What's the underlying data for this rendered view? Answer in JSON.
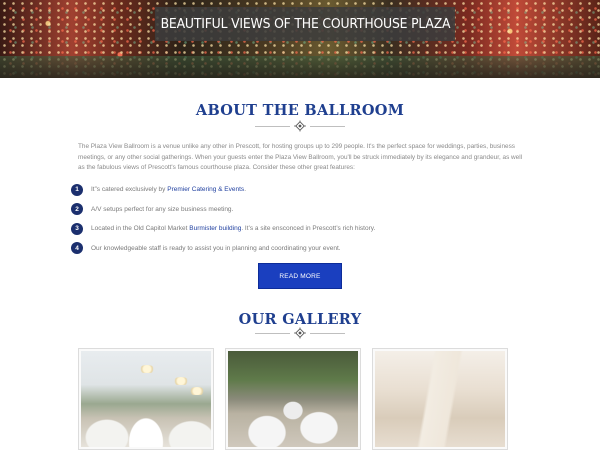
{
  "hero": {
    "title": "BEAUTIFUL VIEWS OF THE COURTHOUSE PLAZA"
  },
  "about": {
    "title": "ABOUT THE BALLROOM",
    "intro": "The Plaza View Ballroom is a venue unlike any other in Prescott, for hosting groups up to 299 people. It's the perfect space for weddings, parties, business meetings, or any other social gatherings. When your guests enter the Plaza View Ballroom, you'll be struck immediately by its elegance and grandeur, as well as the fabulous views of Prescott's famous courthouse plaza. Consider these other great features:",
    "features": [
      {
        "num": "1",
        "text_before": "It”s catered exclusively by ",
        "link": "Premier Catering & Events",
        "text_after": "."
      },
      {
        "num": "2",
        "text_before": "A/V setups perfect for any size business meeting.",
        "link": "",
        "text_after": ""
      },
      {
        "num": "3",
        "text_before": "Located in the Old Capitol Market ",
        "link": "Burmister building",
        "text_after": ". It’s a site ensconced in Prescott’s rich history."
      },
      {
        "num": "4",
        "text_before": "Our knowledgeable staff is ready to assist you in planning and coordinating your event.",
        "link": "",
        "text_after": ""
      }
    ],
    "read_more_label": "READ MORE"
  },
  "gallery": {
    "title": "OUR GALLERY"
  },
  "colors": {
    "heading": "#1f3f8f",
    "badge": "#1b2f6e",
    "button": "#1a3fbf",
    "link": "#1f3f9f"
  }
}
